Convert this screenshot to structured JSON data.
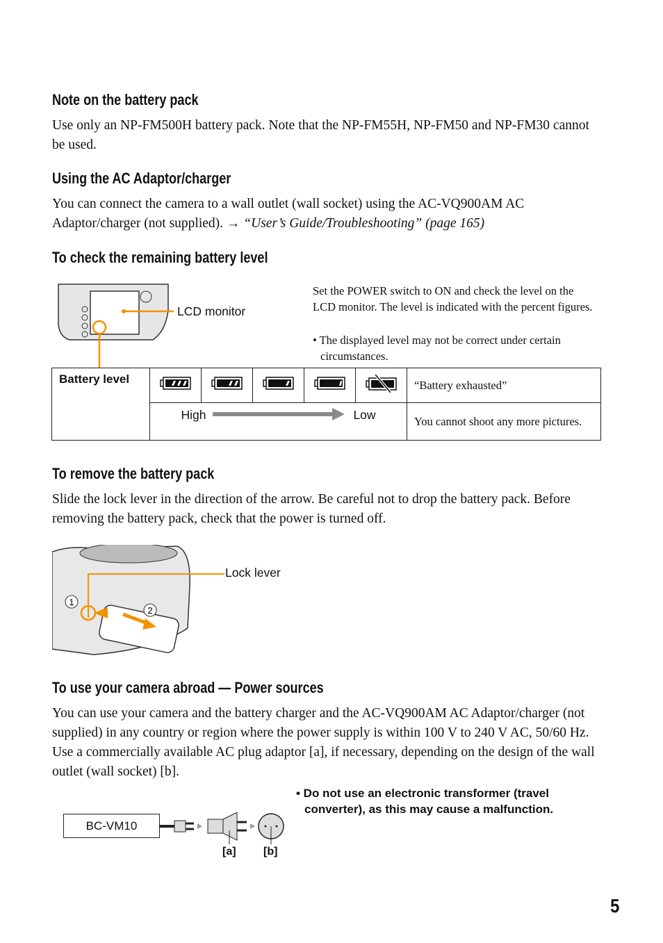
{
  "sections": {
    "battery_note": {
      "heading": "Note on the battery pack",
      "body": "Use only an NP-FM500H battery pack. Note that the NP-FM55H, NP-FM50 and NP-FM30 cannot be used."
    },
    "ac_adaptor": {
      "heading": "Using the AC Adaptor/charger",
      "body": "You can connect the camera to a wall outlet (wall socket) using the AC-VQ900AM AC Adaptor/charger (not supplied). → ",
      "ref": "“User’s Guide/Troubleshooting” (page 165)"
    },
    "check_level": {
      "heading": "To check the remaining battery level",
      "lcd_label": "LCD monitor",
      "desc": "Set the POWER switch to ON and check the level on the LCD monitor. The level is indicated with the percent figures.",
      "bullet": "• The displayed level may not be correct under certain circumstances.",
      "table": {
        "row_label": "Battery level",
        "icons": [
          {
            "name": "battery-full-icon",
            "bars": 3
          },
          {
            "name": "battery-two-thirds-icon",
            "bars": 2
          },
          {
            "name": "battery-one-third-icon",
            "bars": 1
          },
          {
            "name": "battery-low-icon",
            "bars": 0
          },
          {
            "name": "battery-exhausted-icon",
            "bars": -1
          }
        ],
        "exhausted_label": "“Battery exhausted”",
        "high": "High",
        "low": "Low",
        "exhausted_note": "You cannot shoot any more pictures."
      }
    },
    "remove": {
      "heading": "To remove the battery pack",
      "body": "Slide the lock lever in the direction of the arrow. Be careful not to drop the battery pack. Before removing the battery pack, check that the power is turned off.",
      "lock_label": "Lock lever",
      "step1": "1",
      "step2": "2"
    },
    "abroad": {
      "heading": "To use your camera abroad — Power sources",
      "body": "You can use your camera and the battery charger and the AC-VQ900AM AC Adaptor/charger (not supplied) in any country or region where the power supply is within 100 V to 240 V AC, 50/60 Hz. Use a commercially available AC plug adaptor [a], if necessary, depending on the design of the wall outlet (wall socket) [b].",
      "warning": "• Do not use an electronic transformer (travel converter), as this may cause a malfunction.",
      "charger": "BC-VM10",
      "label_a": "[a]",
      "label_b": "[b]"
    }
  },
  "page_number": "5",
  "colors": {
    "accent": "#f39200",
    "arrow": "#8a8a8a"
  }
}
